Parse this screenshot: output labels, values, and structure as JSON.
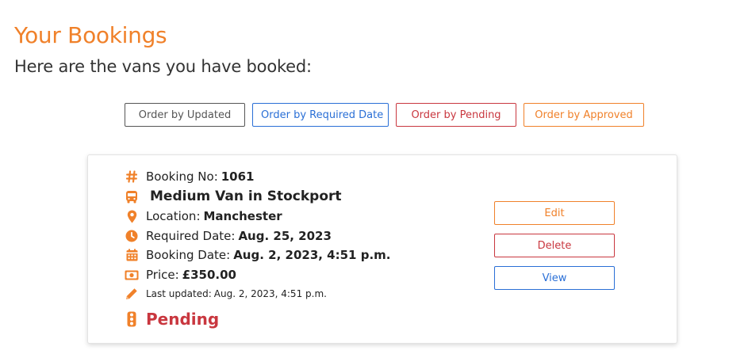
{
  "header": {
    "title": "Your Bookings",
    "subtitle": "Here are the vans you have booked:"
  },
  "sort_buttons": {
    "updated": "Order by Updated",
    "required": "Order by Required Date",
    "pending": "Order by Pending",
    "approved": "Order by Approved"
  },
  "booking": {
    "number_label": "Booking No:",
    "number": "1061",
    "van_title": "Medium Van in Stockport",
    "location_label": "Location:",
    "location": "Manchester",
    "required_label": "Required Date:",
    "required_date": "Aug. 25, 2023",
    "booking_date_label": "Booking Date:",
    "booking_date": "Aug. 2, 2023, 4:51 p.m.",
    "price_label": "Price:",
    "price": "£350.00",
    "updated_label": "Last updated:",
    "updated": "Aug. 2, 2023, 4:51 p.m.",
    "status": "Pending",
    "actions": {
      "edit": "Edit",
      "delete": "Delete",
      "view": "View"
    }
  },
  "icons": {
    "booking_no": "hash-icon",
    "van": "bus-icon",
    "location": "map-pin-icon",
    "required_date": "clock-icon",
    "booking_date": "calendar-icon",
    "price": "money-bill-icon",
    "updated": "pencil-icon",
    "status": "traffic-light-icon"
  },
  "colors": {
    "accent": "#f0812a",
    "danger": "#c9373f",
    "primary": "#2a6fd6",
    "secondary": "#555555"
  }
}
